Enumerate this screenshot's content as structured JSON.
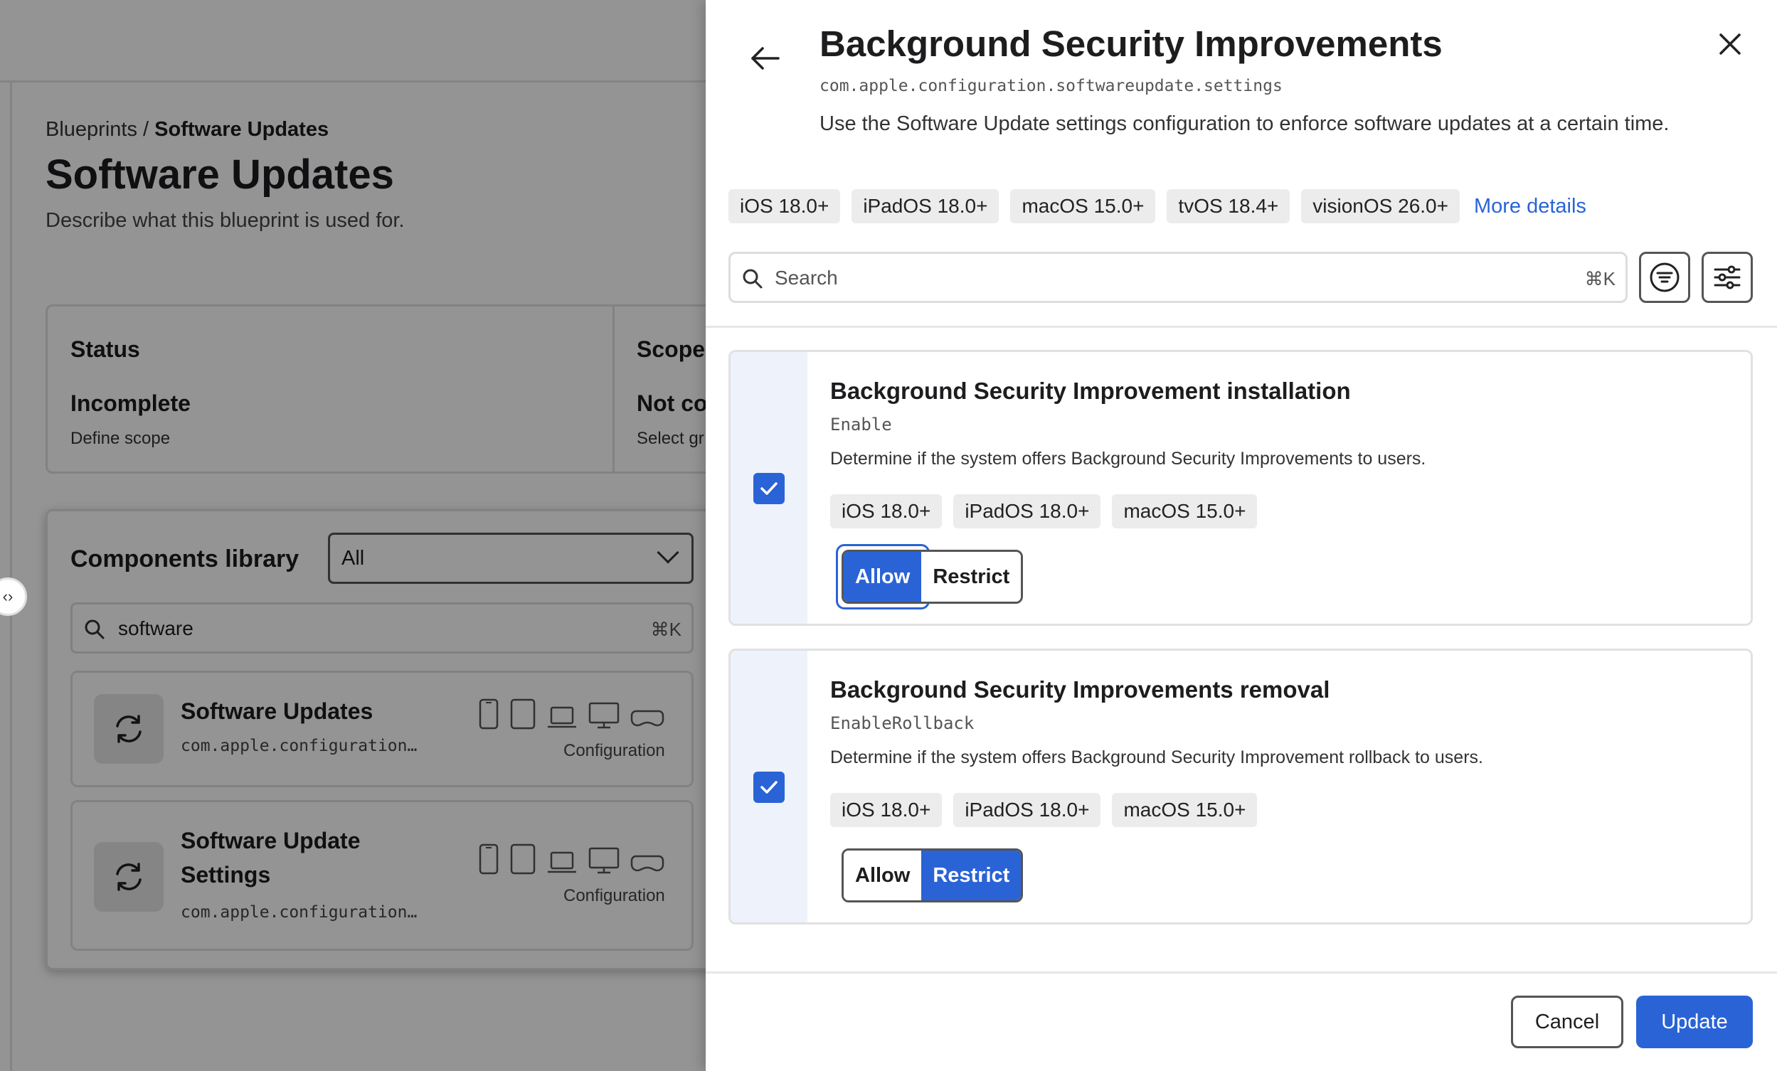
{
  "background": {
    "breadcrumb": {
      "parent": "Blueprints",
      "separator": "/",
      "current": "Software Updates"
    },
    "title": "Software Updates",
    "description": "Describe what this blueprint is used for.",
    "status_card": {
      "status_label": "Status",
      "status_value": "Incomplete",
      "status_sub": "Define scope",
      "scope_label": "Scope",
      "scope_value": "Not co",
      "scope_sub": "Select gr"
    },
    "library": {
      "title": "Components library",
      "filter_value": "All",
      "search_value": "software",
      "search_shortcut": "⌘K",
      "items": [
        {
          "name": "Software Updates",
          "identifier": "com.apple.configuration…",
          "type": "Configuration"
        },
        {
          "name": "Software Update Settings",
          "identifier": "com.apple.configuration…",
          "type": "Configuration"
        }
      ]
    }
  },
  "drawer": {
    "title": "Background Security Improvements",
    "domain": "com.apple.configuration.softwareupdate.settings",
    "description": "Use the Software Update settings configuration to enforce software updates at a certain time.",
    "os_tags": [
      "iOS 18.0+",
      "iPadOS 18.0+",
      "macOS 15.0+",
      "tvOS 18.4+",
      "visionOS 26.0+"
    ],
    "more_details": "More details",
    "search_placeholder": "Search",
    "search_shortcut": "⌘K",
    "settings": [
      {
        "title": "Background Security Improvement installation",
        "key": "Enable",
        "description": "Determine if the system offers Background Security Improvements to users.",
        "os_tags": [
          "iOS 18.0+",
          "iPadOS 18.0+",
          "macOS 15.0+"
        ],
        "checked": true,
        "options": [
          "Allow",
          "Restrict"
        ],
        "selected": "Allow"
      },
      {
        "title": "Background Security Improvements removal",
        "key": "EnableRollback",
        "description": "Determine if the system offers Background Security Improvement rollback to users.",
        "os_tags": [
          "iOS 18.0+",
          "iPadOS 18.0+",
          "macOS 15.0+"
        ],
        "checked": true,
        "options": [
          "Allow",
          "Restrict"
        ],
        "selected": "Restrict"
      }
    ],
    "cancel_label": "Cancel",
    "update_label": "Update"
  },
  "colors": {
    "accent": "#2a63d6",
    "overlay": "rgba(0,0,0,0.42)",
    "tag_bg": "#ececec",
    "rail_bg": "#eef2fb"
  },
  "icons": [
    "back-arrow-icon",
    "close-icon",
    "search-icon",
    "filter-icon",
    "sliders-icon",
    "checkmark-icon",
    "sync-icon",
    "iphone-icon",
    "ipad-icon",
    "laptop-icon",
    "desktop-icon",
    "vision-pro-icon",
    "chevron-down-icon",
    "code-icon"
  ]
}
